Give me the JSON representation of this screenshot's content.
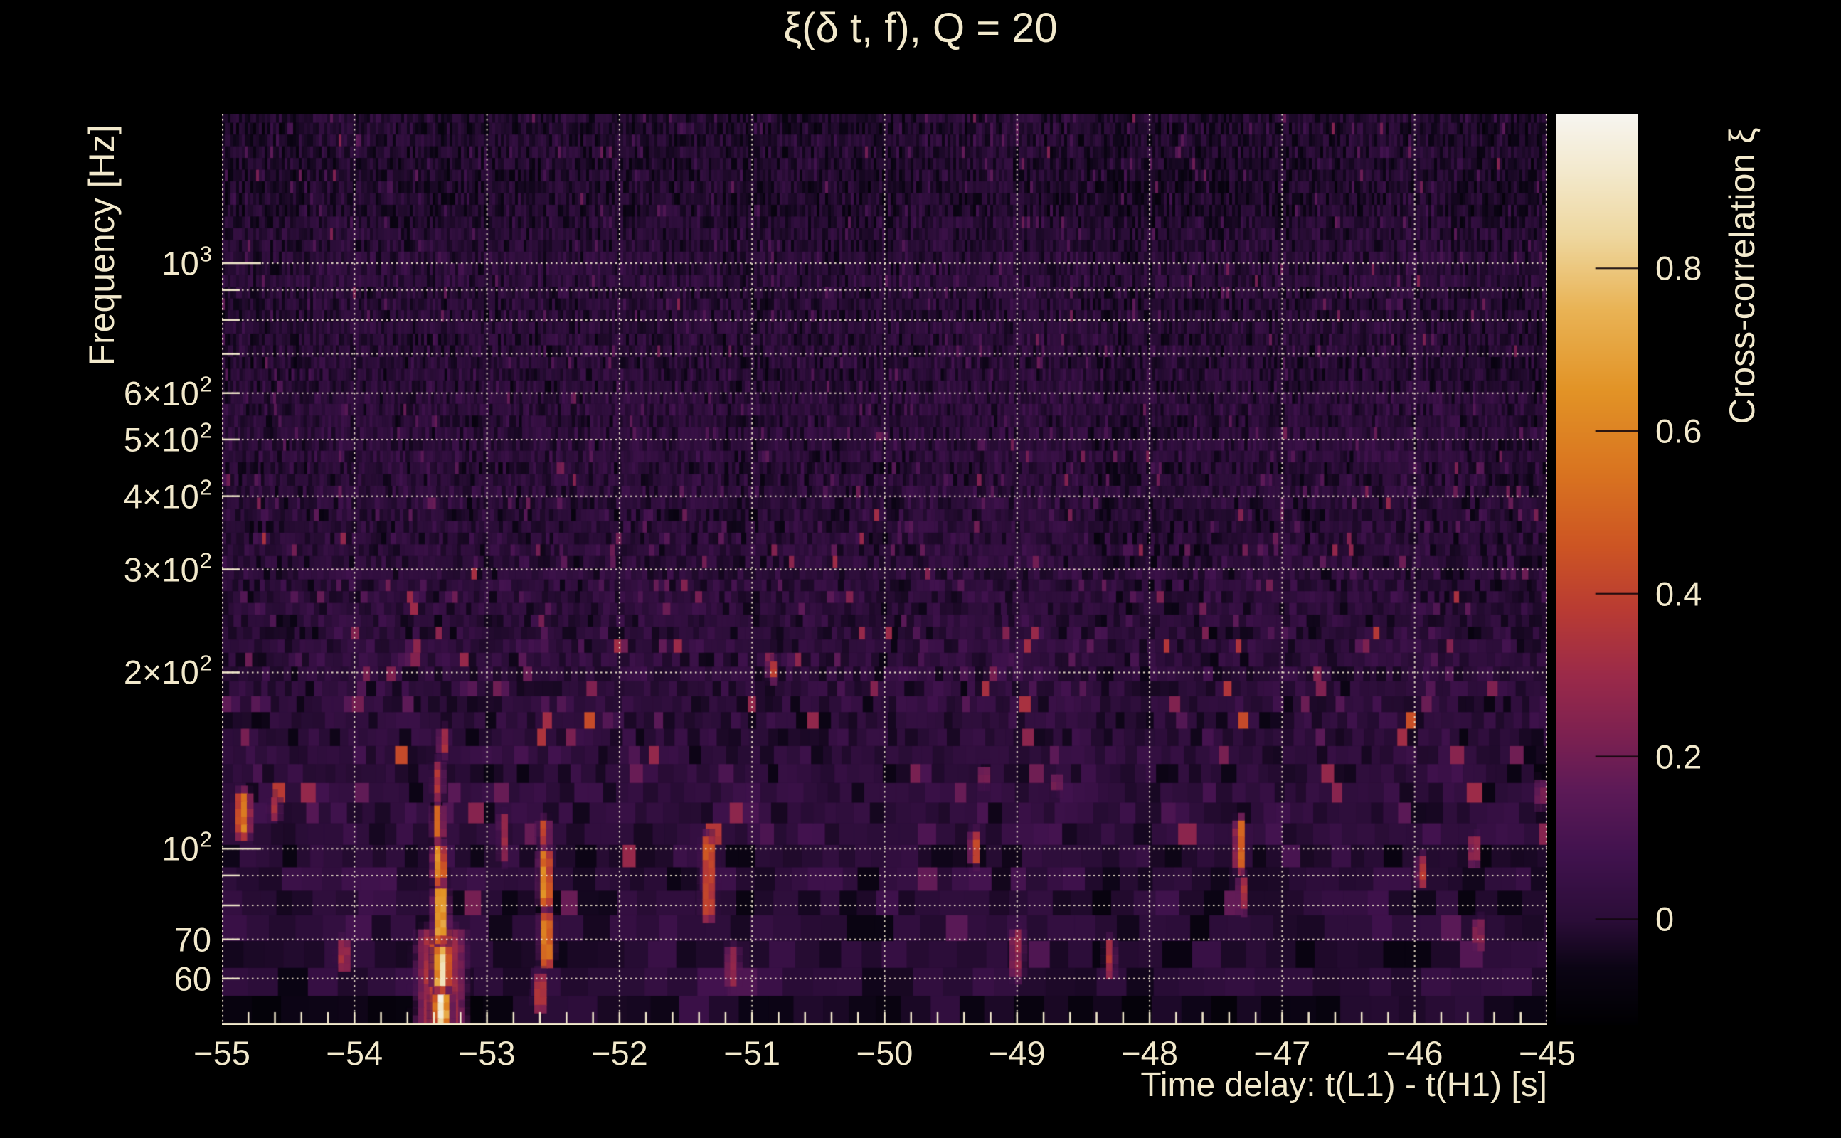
{
  "colors": {
    "figure_background": "#000000",
    "text": "#f2e9cc",
    "gridline": "#f5ecd2",
    "axis_line": "#f2e9cc",
    "heatmap_background": "#2b0d38",
    "colorbar_tick": "#12070d"
  },
  "header": {
    "title": "ξ(δ t, f), Q = 20"
  },
  "axes": {
    "x_title": "Time delay: t(L1) - t(H1) [s]",
    "y_title": "Frequency [Hz]",
    "x_ticks": [
      {
        "t": -55,
        "label": "−55"
      },
      {
        "t": -54,
        "label": "−54"
      },
      {
        "t": -53,
        "label": "−53"
      },
      {
        "t": -52,
        "label": "−52"
      },
      {
        "t": -51,
        "label": "−51"
      },
      {
        "t": -50,
        "label": "−50"
      },
      {
        "t": -49,
        "label": "−49"
      },
      {
        "t": -48,
        "label": "−48"
      },
      {
        "t": -47,
        "label": "−47"
      },
      {
        "t": -46,
        "label": "−46"
      },
      {
        "t": -45,
        "label": "−45"
      }
    ],
    "y_tick_labels": [
      {
        "hz": 1000,
        "base": "10",
        "sup": "3"
      },
      {
        "hz": 600,
        "base": "6×10",
        "sup": "2"
      },
      {
        "hz": 500,
        "base": "5×10",
        "sup": "2"
      },
      {
        "hz": 400,
        "base": "4×10",
        "sup": "2"
      },
      {
        "hz": 300,
        "base": "3×10",
        "sup": "2"
      },
      {
        "hz": 200,
        "base": "2×10",
        "sup": "2"
      },
      {
        "hz": 100,
        "base": "10",
        "sup": "2"
      },
      {
        "hz": 70,
        "base": "70",
        "sup": ""
      },
      {
        "hz": 60,
        "base": "60",
        "sup": ""
      }
    ]
  },
  "colorbar": {
    "title": "Cross-correlation ξ",
    "ticks": [
      {
        "v": 0.8,
        "label": "0.8"
      },
      {
        "v": 0.6,
        "label": "0.6"
      },
      {
        "v": 0.4,
        "label": "0.4"
      },
      {
        "v": 0.2,
        "label": "0.2"
      },
      {
        "v": 0.0,
        "label": "0"
      }
    ]
  },
  "chart_data": {
    "type": "heatmap",
    "title": "ξ(δ t, f), Q = 20",
    "q_value": 20,
    "xlabel": "Time delay: t(L1) - t(H1) [s]",
    "ylabel": "Frequency [Hz]",
    "x_range_s": [
      -55,
      -45
    ],
    "x_major_tick_step_s": 1,
    "x_minor_tick_step_s": 0.2,
    "y_scale": "log",
    "y_range_hz": [
      50,
      1800
    ],
    "y_gridlines_hz": [
      60,
      70,
      80,
      90,
      100,
      200,
      300,
      400,
      500,
      600,
      700,
      800,
      900,
      1000
    ],
    "grid": "dotted",
    "colorbar_label": "Cross-correlation ξ",
    "colorbar_range": [
      -0.13,
      0.99
    ],
    "colorbar_ticks": [
      0,
      0.2,
      0.4,
      0.6,
      0.8
    ],
    "colormap_stops": [
      [
        -0.13,
        "#000002"
      ],
      [
        -0.06,
        "#0b0414"
      ],
      [
        0.0,
        "#2b0d38"
      ],
      [
        0.08,
        "#41124e"
      ],
      [
        0.16,
        "#5d1a57"
      ],
      [
        0.23,
        "#7e2150"
      ],
      [
        0.3,
        "#9b2a49"
      ],
      [
        0.38,
        "#b93b33"
      ],
      [
        0.46,
        "#cd5523"
      ],
      [
        0.55,
        "#d97420"
      ],
      [
        0.65,
        "#e29326"
      ],
      [
        0.75,
        "#e9b355"
      ],
      [
        0.84,
        "#eed79f"
      ],
      [
        0.92,
        "#f3e9cd"
      ],
      [
        0.99,
        "#f7f5f0"
      ]
    ],
    "background_noise": {
      "seed": 1337,
      "baseline_xi": 0.0,
      "xi_std": 0.075,
      "description": "dark-purple Q-transform tile noise; tiles narrow at high frequency, wide at low frequency; sparse faint red-orange speckles mostly below 250 Hz"
    },
    "features": [
      {
        "t": -53.35,
        "f_lo": 50,
        "f_hi": 75,
        "xi": 0.45,
        "sigma_s": 0.12
      },
      {
        "t": -53.34,
        "f_lo": 50,
        "f_hi": 58,
        "xi": 0.97,
        "sigma_s": 0.045
      },
      {
        "t": -53.34,
        "f_lo": 58,
        "f_hi": 70,
        "xi": 0.95,
        "sigma_s": 0.04
      },
      {
        "t": -53.35,
        "f_lo": 70,
        "f_hi": 88,
        "xi": 0.85,
        "sigma_s": 0.035
      },
      {
        "t": -53.36,
        "f_lo": 88,
        "f_hi": 104,
        "xi": 0.72,
        "sigma_s": 0.032
      },
      {
        "t": -53.37,
        "f_lo": 104,
        "f_hi": 122,
        "xi": 0.5,
        "sigma_s": 0.03
      },
      {
        "t": -53.37,
        "f_lo": 122,
        "f_hi": 145,
        "xi": 0.33,
        "sigma_s": 0.03
      },
      {
        "t": -53.33,
        "f_lo": 145,
        "f_hi": 165,
        "xi": 0.38,
        "sigma_s": 0.025
      },
      {
        "t": -52.55,
        "f_lo": 63,
        "f_hi": 80,
        "xi": 0.6,
        "sigma_s": 0.035
      },
      {
        "t": -52.56,
        "f_lo": 80,
        "f_hi": 102,
        "xi": 0.62,
        "sigma_s": 0.033
      },
      {
        "t": -52.57,
        "f_lo": 102,
        "f_hi": 115,
        "xi": 0.45,
        "sigma_s": 0.03
      },
      {
        "t": -52.6,
        "f_lo": 53,
        "f_hi": 63,
        "xi": 0.38,
        "sigma_s": 0.035
      },
      {
        "t": -52.88,
        "f_lo": 95,
        "f_hi": 118,
        "xi": 0.3,
        "sigma_s": 0.025
      },
      {
        "t": -54.84,
        "f_lo": 105,
        "f_hi": 128,
        "xi": 0.58,
        "sigma_s": 0.04
      },
      {
        "t": -54.6,
        "f_lo": 112,
        "f_hi": 126,
        "xi": 0.33,
        "sigma_s": 0.03
      },
      {
        "t": -54.08,
        "f_lo": 62,
        "f_hi": 72,
        "xi": 0.35,
        "sigma_s": 0.035
      },
      {
        "t": -51.33,
        "f_lo": 76,
        "f_hi": 108,
        "xi": 0.5,
        "sigma_s": 0.035
      },
      {
        "t": -51.15,
        "f_lo": 58,
        "f_hi": 70,
        "xi": 0.3,
        "sigma_s": 0.04
      },
      {
        "t": -50.85,
        "f_lo": 195,
        "f_hi": 215,
        "xi": 0.38,
        "sigma_s": 0.025
      },
      {
        "t": -50.02,
        "f_lo": 500,
        "f_hi": 530,
        "xi": 0.32,
        "sigma_s": 0.02
      },
      {
        "t": -49.32,
        "f_lo": 94,
        "f_hi": 110,
        "xi": 0.42,
        "sigma_s": 0.025
      },
      {
        "t": -49.25,
        "f_lo": 128,
        "f_hi": 142,
        "xi": 0.32,
        "sigma_s": 0.02
      },
      {
        "t": -49.0,
        "f_lo": 60,
        "f_hi": 75,
        "xi": 0.28,
        "sigma_s": 0.04
      },
      {
        "t": -48.7,
        "f_lo": 125,
        "f_hi": 138,
        "xi": 0.3,
        "sigma_s": 0.02
      },
      {
        "t": -48.3,
        "f_lo": 60,
        "f_hi": 72,
        "xi": 0.33,
        "sigma_s": 0.03
      },
      {
        "t": -47.32,
        "f_lo": 92,
        "f_hi": 115,
        "xi": 0.55,
        "sigma_s": 0.025
      },
      {
        "t": -47.3,
        "f_lo": 78,
        "f_hi": 92,
        "xi": 0.36,
        "sigma_s": 0.025
      },
      {
        "t": -45.95,
        "f_lo": 86,
        "f_hi": 100,
        "xi": 0.38,
        "sigma_s": 0.025
      },
      {
        "t": -45.55,
        "f_lo": 94,
        "f_hi": 108,
        "xi": 0.42,
        "sigma_s": 0.022
      },
      {
        "t": -45.52,
        "f_lo": 67,
        "f_hi": 78,
        "xi": 0.36,
        "sigma_s": 0.022
      },
      {
        "t": -45.05,
        "f_lo": 118,
        "f_hi": 135,
        "xi": 0.33,
        "sigma_s": 0.02
      }
    ]
  }
}
